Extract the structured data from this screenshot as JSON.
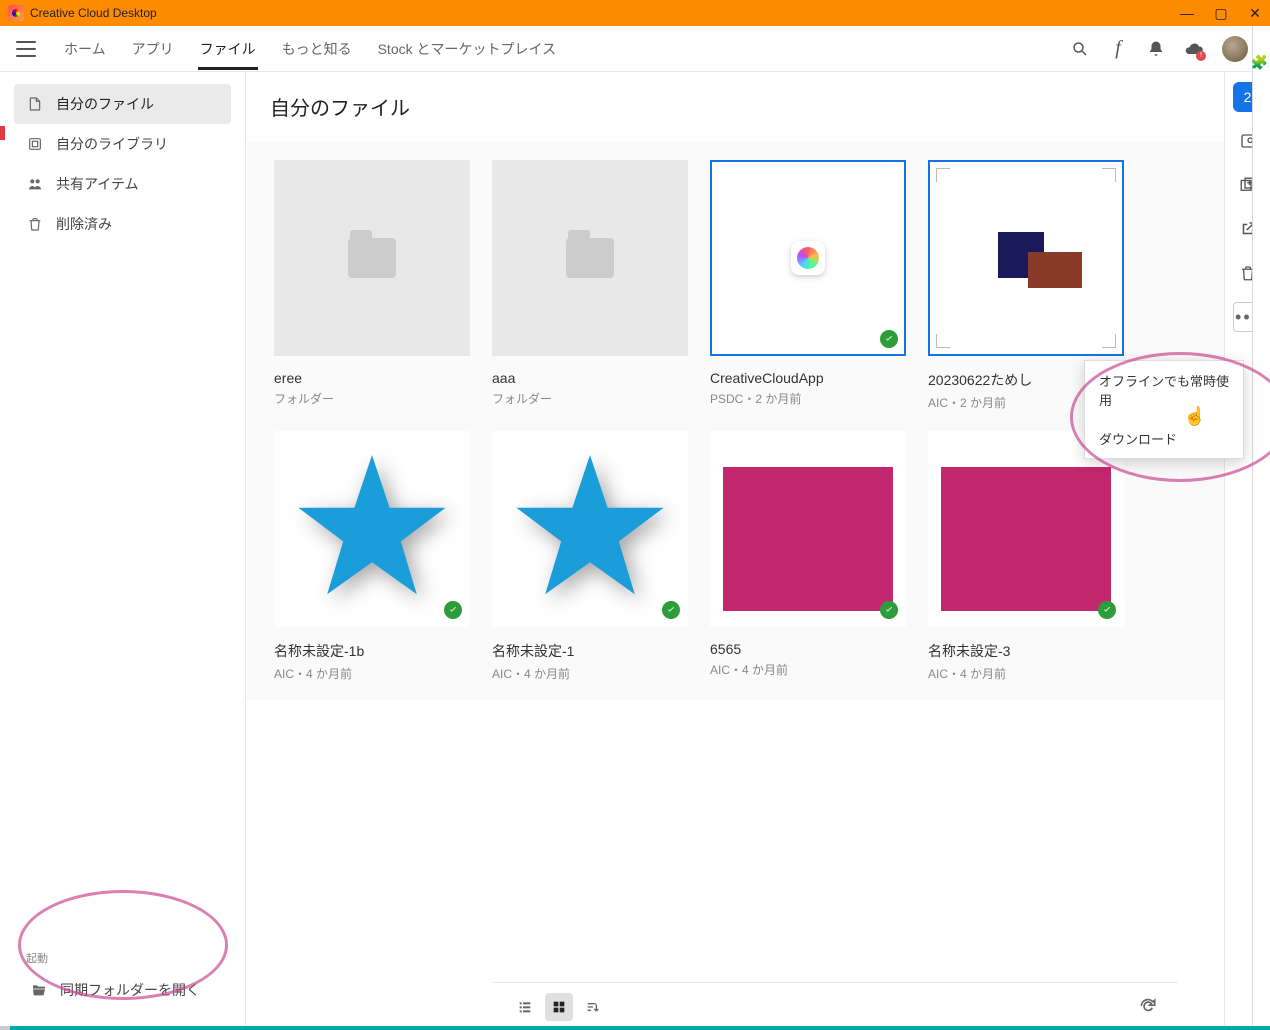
{
  "window": {
    "title": "Creative Cloud Desktop"
  },
  "nav": {
    "tabs": [
      "ホーム",
      "アプリ",
      "ファイル",
      "もっと知る",
      "Stock とマーケットプレイス"
    ],
    "activeIndex": 2
  },
  "sidebar": {
    "items": [
      {
        "icon": "file",
        "label": "自分のファイル",
        "active": true
      },
      {
        "icon": "library",
        "label": "自分のライブラリ",
        "active": false
      },
      {
        "icon": "share",
        "label": "共有アイテム",
        "active": false
      },
      {
        "icon": "trash",
        "label": "削除済み",
        "active": false
      }
    ],
    "bottomLabel": "起動",
    "bottomItemLabel": "同期フォルダーを開く"
  },
  "page": {
    "heading": "自分のファイル"
  },
  "rail": {
    "selectionCount": "2"
  },
  "contextMenu": {
    "items": [
      "オフラインでも常時使用",
      "ダウンロード"
    ]
  },
  "cards": [
    {
      "title": "eree",
      "meta": "フォルダー",
      "kind": "folder",
      "synced": false,
      "selected": false
    },
    {
      "title": "aaa",
      "meta": "フォルダー",
      "kind": "folder",
      "synced": false,
      "selected": false
    },
    {
      "title": "CreativeCloudApp",
      "meta": "PSDC・2 か月前",
      "kind": "ccapp",
      "synced": true,
      "selected": true
    },
    {
      "title": "20230622ためし",
      "meta": "AIC・2 か月前",
      "kind": "aic-art",
      "synced": false,
      "selected": true
    },
    {
      "title": "名称未設定-1b",
      "meta": "AIC・4 か月前",
      "kind": "star",
      "synced": true,
      "selected": false
    },
    {
      "title": "名称未設定-1",
      "meta": "AIC・4 か月前",
      "kind": "star",
      "synced": true,
      "selected": false
    },
    {
      "title": "6565",
      "meta": "AIC・4 か月前",
      "kind": "pink",
      "synced": true,
      "selected": false
    },
    {
      "title": "名称未設定-3",
      "meta": "AIC・4 か月前",
      "kind": "pink",
      "synced": true,
      "selected": false
    }
  ]
}
